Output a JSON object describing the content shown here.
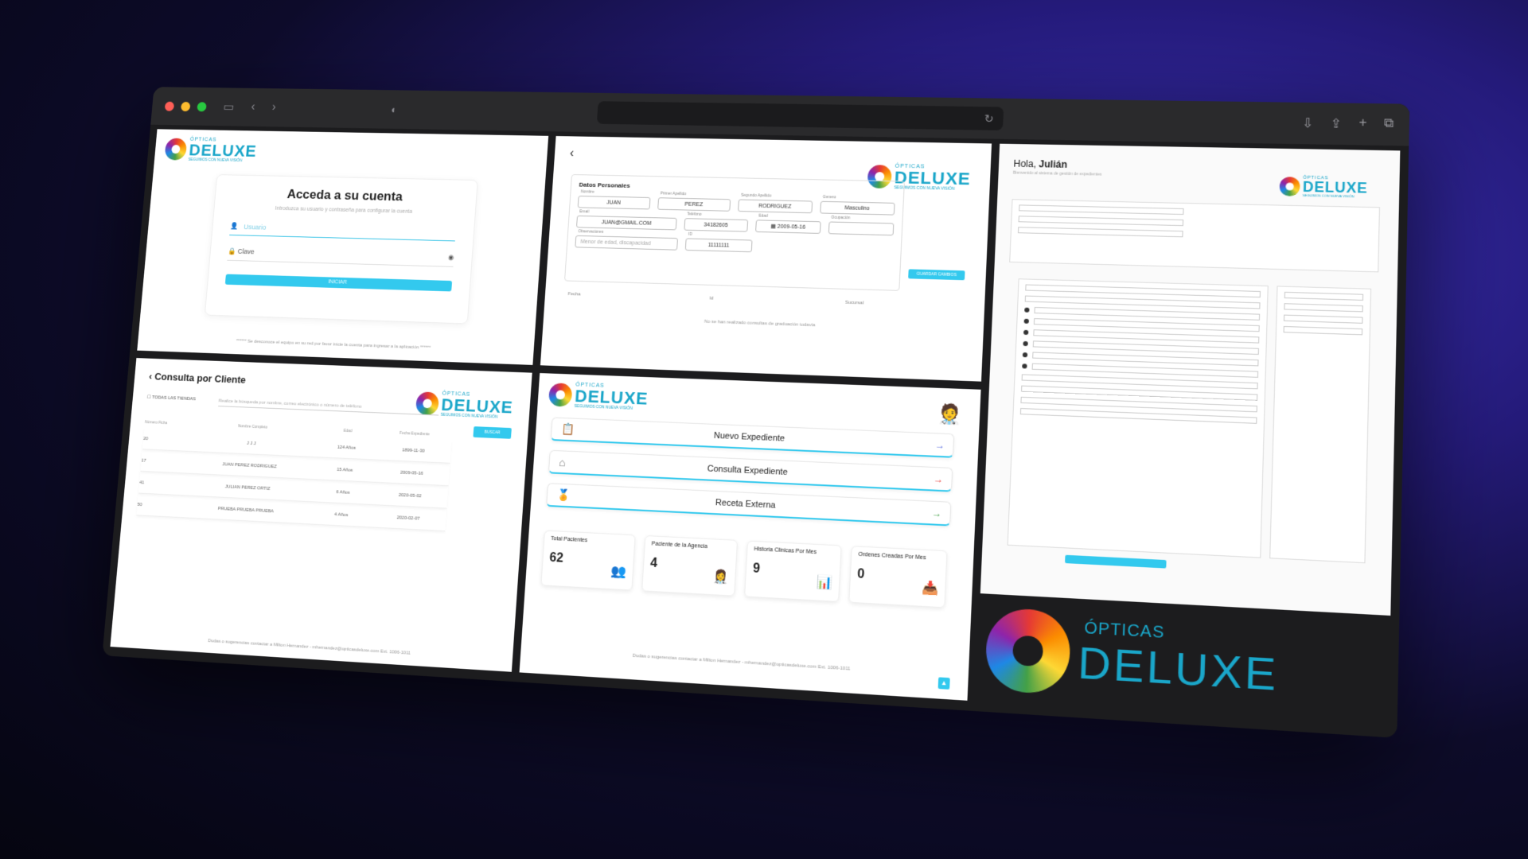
{
  "brand": {
    "small": "ÓPTICAS",
    "big": "DELUXE",
    "tagline": "SEGUIMOS CON NUEVA VISIÓN"
  },
  "login": {
    "title": "Acceda a su cuenta",
    "subtitle": "Introduzca su usuario y contraseña para configurar la cuenta",
    "user_placeholder": "Usuario",
    "password_value": "Clave",
    "button_label": "INICIAR",
    "footer": "****** Se desconoce el equipo en su red por favor inicie la cuenta para ingresar a la aplicación ******"
  },
  "form": {
    "section_title": "Datos Personales",
    "nombre": "JUAN",
    "primer_apellido": "PEREZ",
    "segundo_apellido": "RODRIGUEZ",
    "genero": "Masculino",
    "email": "JUAN@GMAIL.COM",
    "telefono": "34182605",
    "fecha": "2009-05-16",
    "ocupacion": "",
    "observaciones_placeholder": "Menor de edad, discapacidad",
    "cedula": "11111111",
    "label_nombre": "Nombre",
    "label_primer_apellido": "Primer Apellido",
    "label_segundo_apellido": "Segundo Apellido",
    "label_genero": "Genero",
    "label_email": "Email",
    "label_telefono": "Teléfono",
    "label_fecha": "Edad",
    "label_ocupacion": "Ocupación",
    "label_observaciones": "Observaciones",
    "label_cedula": "ID",
    "save_label": "GUARDAR CAMBIOS",
    "hist_fecha": "Fecha",
    "hist_id": "Id",
    "hist_sucursal": "Sucursal",
    "hist_empty": "No se han realizado consultas de graduación todavía"
  },
  "right": {
    "greeting": "Hola, ",
    "user": "Julián",
    "subtitle": "Bienvenido al sistema de gestión de expedientes"
  },
  "consulta": {
    "title": "Consulta por Cliente",
    "check_label": "TODAS LAS TIENDAS",
    "search_placeholder": "Realice la búsqueda por nombre, correo electrónico o número de teléfono",
    "button_label": "BUSCAR",
    "headers": [
      "Número Ficha",
      "Nombre Completo",
      "Edad",
      "Fecha Expediente"
    ],
    "rows": [
      {
        "id": "20",
        "name": "J J J",
        "age": "124 Años",
        "date": "1899-11-30"
      },
      {
        "id": "17",
        "name": "JUAN PEREZ RODRIGUEZ",
        "age": "15 Años",
        "date": "2009-05-16"
      },
      {
        "id": "41",
        "name": "JULIAN PEREZ ORTIZ",
        "age": "6 Años",
        "date": "2020-05-02"
      },
      {
        "id": "50",
        "name": "PRUEBA PRUEBA PRUEBA",
        "age": "4 Años",
        "date": "2020-02-07"
      }
    ],
    "footer": "Dudas o sugerencias contactar a Milton Hernandez - mhernandez@opticasdeluxe.com Ext. 1006-1011"
  },
  "dashboard": {
    "menu": [
      {
        "label": "Nuevo Expediente",
        "arrow": "→",
        "arrow_color": "#5b6ee1"
      },
      {
        "label": "Consulta Expediente",
        "arrow": "→",
        "arrow_color": "#e53935"
      },
      {
        "label": "Receta Externa",
        "arrow": "→",
        "arrow_color": "#43a047"
      }
    ],
    "stats": [
      {
        "label": "Total Pacientes",
        "value": "62"
      },
      {
        "label": "Paciente de la Agencia",
        "value": "4"
      },
      {
        "label": "Historia Clinicas Por Mes",
        "value": "9"
      },
      {
        "label": "Ordenes Creadas Por Mes",
        "value": "0"
      }
    ],
    "footer": "Dudas o sugerencias contactar a Milton Hernandez - mhernandez@opticasdeluxe.com Ext. 1006-1011"
  }
}
